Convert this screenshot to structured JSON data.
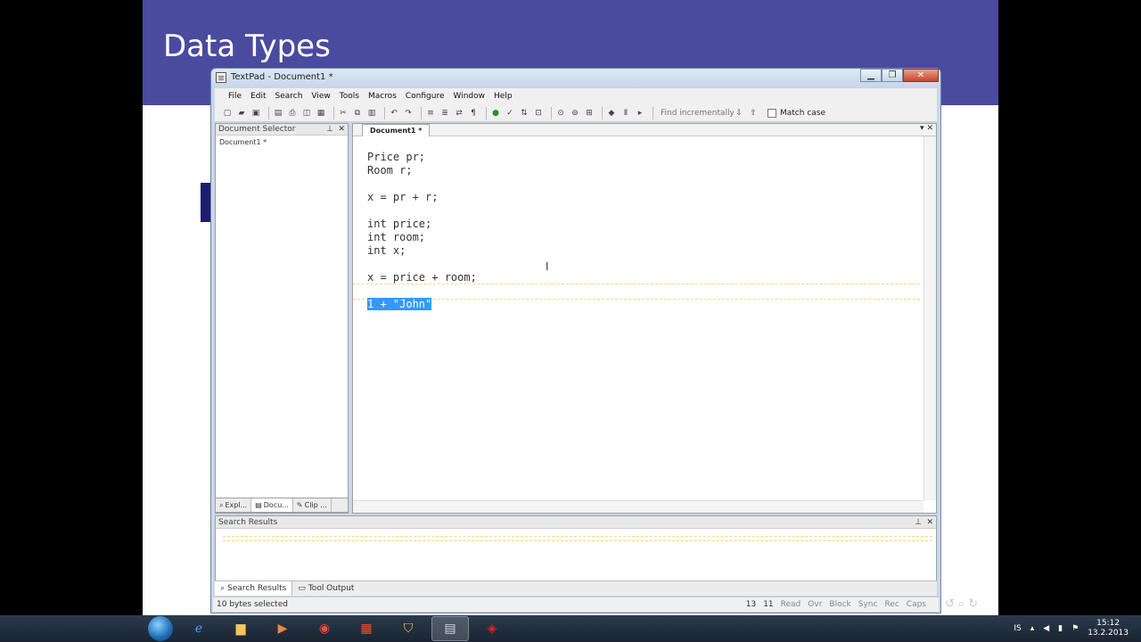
{
  "slide": {
    "title": "Data Types",
    "nav_icons": [
      "undo-icon",
      "search-icon",
      "redo-icon"
    ],
    "colors": {
      "header": "#4a4a9f",
      "accent": "#1d1d6e"
    }
  },
  "window": {
    "title": "TextPad - Document1 *",
    "controls": {
      "minimize": "▁",
      "maximize": "❐",
      "close": "✕"
    }
  },
  "menu": [
    "File",
    "Edit",
    "Search",
    "View",
    "Tools",
    "Macros",
    "Configure",
    "Window",
    "Help"
  ],
  "toolbar": {
    "find_placeholder": "Find incrementally",
    "match_case_label": "Match case"
  },
  "document_selector": {
    "title": "Document Selector",
    "items": [
      "Document1 *"
    ],
    "tabs": [
      "Expl...",
      "Docu...",
      "Clip ..."
    ]
  },
  "editor": {
    "tab_label": "Document1 *",
    "lines": [
      "Price pr;",
      "Room r;",
      "",
      "x = pr + r;",
      "",
      "int price;",
      "int room;",
      "int x;",
      "",
      "x = price + room;",
      "",
      "1 + \"John\""
    ],
    "selected_line_index": 11,
    "selection_color": "#3399ff"
  },
  "search_results": {
    "title": "Search Results",
    "tabs": [
      "Search Results",
      "Tool Output"
    ]
  },
  "statusbar": {
    "message": "10 bytes selected",
    "line": "13",
    "column": "11",
    "flags": [
      "Read",
      "Ovr",
      "Block",
      "Sync",
      "Rec",
      "Caps"
    ]
  },
  "taskbar": {
    "language": "IS",
    "time": "15:12",
    "date": "13.2.2013",
    "apps": [
      "ie-icon",
      "explorer-icon",
      "media-icon",
      "chrome-icon",
      "office-icon",
      "shield-icon",
      "textpad-icon",
      "pdf-icon"
    ]
  }
}
